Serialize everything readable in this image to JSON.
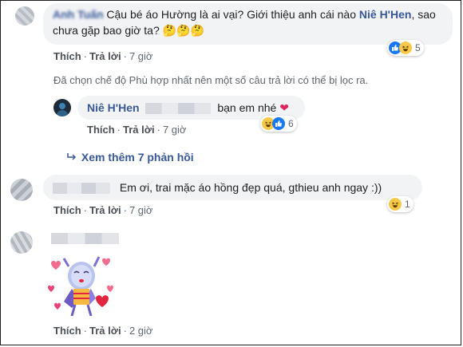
{
  "comment1": {
    "author": "Anh Tuấn",
    "text_a": "Cậu bé áo Hường là ai vại? Giới thiệu anh cái nào ",
    "mention": "Niê H'Hen",
    "text_b": ", sao chưa gặp bao giờ ta?",
    "emoji": "🤔🤔🤔",
    "actions": {
      "like": "Thích",
      "reply": "Trả lời",
      "time": "7 giờ"
    },
    "reactions": {
      "count": "5",
      "icons": [
        "like-icon",
        "haha-icon"
      ]
    }
  },
  "filter_notice": "Đã chọn chế độ Phù hợp nhất nên một số câu trả lời có thể bị lọc ra.",
  "reply1": {
    "author": "Niê H'Hen",
    "text": "bạn em nhé",
    "emoji": "❤",
    "actions": {
      "like": "Thích",
      "reply": "Trả lời",
      "time": "7 giờ"
    },
    "reactions": {
      "count": "6",
      "icons": [
        "haha-icon",
        "like-icon"
      ]
    }
  },
  "view_more": "Xem thêm 7 phản hồi",
  "comment2": {
    "text": "Em ơi, trai mặc áo hồng đẹp quá, gthieu anh ngay :))",
    "actions": {
      "like": "Thích",
      "reply": "Trả lời",
      "time": "7 giờ"
    },
    "reactions": {
      "count": "1",
      "icons": [
        "haha-icon"
      ]
    }
  },
  "comment3": {
    "sticker": "sticker-character-with-hearts",
    "actions": {
      "like": "Thích",
      "reply": "Trả lời",
      "time": "2 giờ"
    }
  },
  "colors": {
    "link": "#385898",
    "bubble": "#f2f3f5",
    "meta": "#606770",
    "like": "#1877f2",
    "haha": "#f7c948",
    "heart": "#f33e58"
  }
}
